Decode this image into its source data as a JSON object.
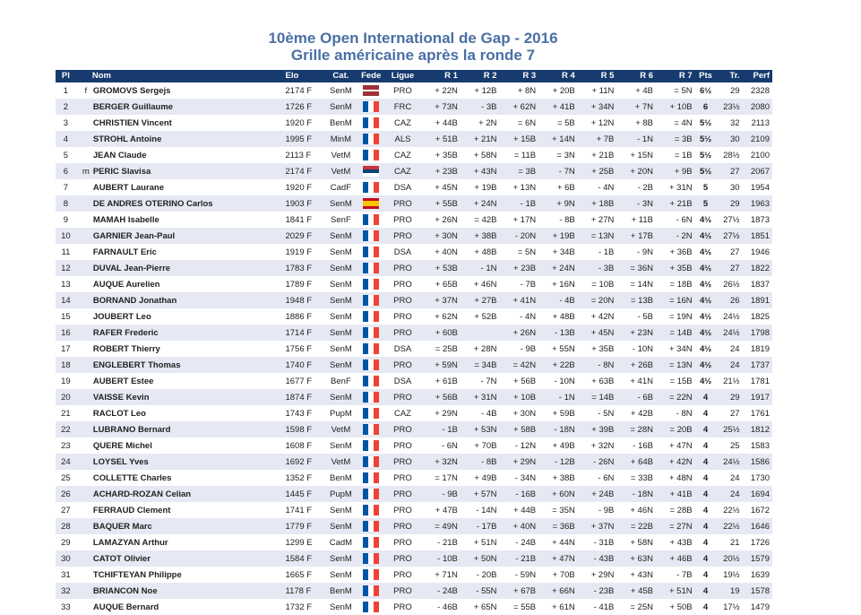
{
  "header": {
    "title": "10ème Open International de Gap - 2016",
    "subtitle": "Grille américaine après la ronde 7"
  },
  "columns": [
    "Pl",
    "Nom",
    "Elo",
    "Cat.",
    "Fede",
    "Ligue",
    "R 1",
    "R 2",
    "R 3",
    "R 4",
    "R 5",
    "R 6",
    "R 7",
    "Pts",
    "Tr.",
    "Perf"
  ],
  "flag_colors": {
    "FRA": [
      "#0055a4",
      "#ffffff",
      "#ef4135"
    ],
    "LAT": [
      "#9e3039",
      "#ffffff",
      "#9e3039"
    ],
    "SRB": [
      "#c6363c",
      "#0c4076",
      "#ffffff"
    ],
    "ESP": [
      "#c60b1e",
      "#ffc400",
      "#c60b1e"
    ]
  },
  "rows": [
    {
      "pl": "1",
      "title": "f",
      "name": "GROMOVS Sergejs",
      "elo": "2174 F",
      "cat": "SenM",
      "fede": "LAT",
      "ligue": "PRO",
      "r": [
        "+ 22N",
        "+ 12B",
        "+ 8N",
        "+ 20B",
        "+ 11N",
        "+ 4B",
        "= 5N"
      ],
      "pts": "6½",
      "tr": "29",
      "perf": "2328"
    },
    {
      "pl": "2",
      "title": "",
      "name": "BERGER Guillaume",
      "elo": "1726 F",
      "cat": "SenM",
      "fede": "FRA",
      "ligue": "FRC",
      "r": [
        "+ 73N",
        "- 3B",
        "+ 62N",
        "+ 41B",
        "+ 34N",
        "+ 7N",
        "+ 10B"
      ],
      "pts": "6",
      "tr": "23½",
      "perf": "2080"
    },
    {
      "pl": "3",
      "title": "",
      "name": "CHRISTIEN Vincent",
      "elo": "1920 F",
      "cat": "BenM",
      "fede": "FRA",
      "ligue": "CAZ",
      "r": [
        "+ 44B",
        "+ 2N",
        "= 6N",
        "= 5B",
        "+ 12N",
        "+ 8B",
        "= 4N"
      ],
      "pts": "5½",
      "tr": "32",
      "perf": "2113"
    },
    {
      "pl": "4",
      "title": "",
      "name": "STROHL Antoine",
      "elo": "1995 F",
      "cat": "MinM",
      "fede": "FRA",
      "ligue": "ALS",
      "r": [
        "+ 51B",
        "+ 21N",
        "+ 15B",
        "+ 14N",
        "+ 7B",
        "- 1N",
        "= 3B"
      ],
      "pts": "5½",
      "tr": "30",
      "perf": "2109"
    },
    {
      "pl": "5",
      "title": "",
      "name": "JEAN Claude",
      "elo": "2113 F",
      "cat": "VetM",
      "fede": "FRA",
      "ligue": "CAZ",
      "r": [
        "+ 35B",
        "+ 58N",
        "= 11B",
        "= 3N",
        "+ 21B",
        "+ 15N",
        "= 1B"
      ],
      "pts": "5½",
      "tr": "28½",
      "perf": "2100"
    },
    {
      "pl": "6",
      "title": "m",
      "name": "PERIC Slavisa",
      "elo": "2174 F",
      "cat": "VetM",
      "fede": "SRB",
      "ligue": "CAZ",
      "r": [
        "+ 23B",
        "+ 43N",
        "= 3B",
        "- 7N",
        "+ 25B",
        "+ 20N",
        "+ 9B"
      ],
      "pts": "5½",
      "tr": "27",
      "perf": "2067"
    },
    {
      "pl": "7",
      "title": "",
      "name": "AUBERT Laurane",
      "elo": "1920 F",
      "cat": "CadF",
      "fede": "FRA",
      "ligue": "DSA",
      "r": [
        "+ 45N",
        "+ 19B",
        "+ 13N",
        "+ 6B",
        "- 4N",
        "- 2B",
        "+ 31N"
      ],
      "pts": "5",
      "tr": "30",
      "perf": "1954"
    },
    {
      "pl": "8",
      "title": "",
      "name": "DE ANDRES OTERINO Carlos",
      "elo": "1903 F",
      "cat": "SenM",
      "fede": "ESP",
      "ligue": "PRO",
      "r": [
        "+ 55B",
        "+ 24N",
        "- 1B",
        "+ 9N",
        "+ 18B",
        "- 3N",
        "+ 21B"
      ],
      "pts": "5",
      "tr": "29",
      "perf": "1963"
    },
    {
      "pl": "9",
      "title": "",
      "name": "MAMAH Isabelle",
      "elo": "1841 F",
      "cat": "SenF",
      "fede": "FRA",
      "ligue": "PRO",
      "r": [
        "+ 26N",
        "= 42B",
        "+ 17N",
        "- 8B",
        "+ 27N",
        "+ 11B",
        "- 6N"
      ],
      "pts": "4½",
      "tr": "27½",
      "perf": "1873"
    },
    {
      "pl": "10",
      "title": "",
      "name": "GARNIER Jean-Paul",
      "elo": "2029 F",
      "cat": "SenM",
      "fede": "FRA",
      "ligue": "PRO",
      "r": [
        "+ 30N",
        "+ 38B",
        "- 20N",
        "+ 19B",
        "= 13N",
        "+ 17B",
        "- 2N"
      ],
      "pts": "4½",
      "tr": "27½",
      "perf": "1851"
    },
    {
      "pl": "11",
      "title": "",
      "name": "FARNAULT Eric",
      "elo": "1919 F",
      "cat": "SenM",
      "fede": "FRA",
      "ligue": "DSA",
      "r": [
        "+ 40N",
        "+ 48B",
        "= 5N",
        "+ 34B",
        "- 1B",
        "- 9N",
        "+ 36B"
      ],
      "pts": "4½",
      "tr": "27",
      "perf": "1946"
    },
    {
      "pl": "12",
      "title": "",
      "name": "DUVAL Jean-Pierre",
      "elo": "1783 F",
      "cat": "SenM",
      "fede": "FRA",
      "ligue": "PRO",
      "r": [
        "+ 53B",
        "- 1N",
        "+ 23B",
        "+ 24N",
        "- 3B",
        "= 36N",
        "+ 35B"
      ],
      "pts": "4½",
      "tr": "27",
      "perf": "1822"
    },
    {
      "pl": "13",
      "title": "",
      "name": "AUQUE Aurelien",
      "elo": "1789 F",
      "cat": "SenM",
      "fede": "FRA",
      "ligue": "PRO",
      "r": [
        "+ 65B",
        "+ 46N",
        "- 7B",
        "+ 16N",
        "= 10B",
        "= 14N",
        "= 18B"
      ],
      "pts": "4½",
      "tr": "26½",
      "perf": "1837"
    },
    {
      "pl": "14",
      "title": "",
      "name": "BORNAND Jonathan",
      "elo": "1948 F",
      "cat": "SenM",
      "fede": "FRA",
      "ligue": "PRO",
      "r": [
        "+ 37N",
        "+ 27B",
        "+ 41N",
        "- 4B",
        "= 20N",
        "= 13B",
        "= 16N"
      ],
      "pts": "4½",
      "tr": "26",
      "perf": "1891"
    },
    {
      "pl": "15",
      "title": "",
      "name": "JOUBERT Leo",
      "elo": "1886 F",
      "cat": "SenM",
      "fede": "FRA",
      "ligue": "PRO",
      "r": [
        "+ 62N",
        "+ 52B",
        "- 4N",
        "+ 48B",
        "+ 42N",
        "- 5B",
        "= 19N"
      ],
      "pts": "4½",
      "tr": "24½",
      "perf": "1825"
    },
    {
      "pl": "16",
      "title": "",
      "name": "RAFER Frederic",
      "elo": "1714 F",
      "cat": "SenM",
      "fede": "FRA",
      "ligue": "PRO",
      "r": [
        "+ 60B",
        "",
        "+ 26N",
        "- 13B",
        "+ 45N",
        "+ 23N",
        "= 14B"
      ],
      "pts": "4½",
      "tr": "24½",
      "perf": "1798"
    },
    {
      "pl": "17",
      "title": "",
      "name": "ROBERT Thierry",
      "elo": "1756 F",
      "cat": "SenM",
      "fede": "FRA",
      "ligue": "DSA",
      "r": [
        "= 25B",
        "+ 28N",
        "- 9B",
        "+ 55N",
        "+ 35B",
        "- 10N",
        "+ 34N"
      ],
      "pts": "4½",
      "tr": "24",
      "perf": "1819"
    },
    {
      "pl": "18",
      "title": "",
      "name": "ENGLEBERT Thomas",
      "elo": "1740 F",
      "cat": "SenM",
      "fede": "FRA",
      "ligue": "PRO",
      "r": [
        "+ 59N",
        "= 34B",
        "= 42N",
        "+ 22B",
        "- 8N",
        "+ 26B",
        "= 13N"
      ],
      "pts": "4½",
      "tr": "24",
      "perf": "1737"
    },
    {
      "pl": "19",
      "title": "",
      "name": "AUBERT Estee",
      "elo": "1677 F",
      "cat": "BenF",
      "fede": "FRA",
      "ligue": "DSA",
      "r": [
        "+ 61B",
        "- 7N",
        "+ 56B",
        "- 10N",
        "+ 63B",
        "+ 41N",
        "= 15B"
      ],
      "pts": "4½",
      "tr": "21½",
      "perf": "1781"
    },
    {
      "pl": "20",
      "title": "",
      "name": "VAISSE Kevin",
      "elo": "1874 F",
      "cat": "SenM",
      "fede": "FRA",
      "ligue": "PRO",
      "r": [
        "+ 56B",
        "+ 31N",
        "+ 10B",
        "- 1N",
        "= 14B",
        "- 6B",
        "= 22N"
      ],
      "pts": "4",
      "tr": "29",
      "perf": "1917"
    },
    {
      "pl": "21",
      "title": "",
      "name": "RACLOT Leo",
      "elo": "1743 F",
      "cat": "PupM",
      "fede": "FRA",
      "ligue": "CAZ",
      "r": [
        "+ 29N",
        "- 4B",
        "+ 30N",
        "+ 59B",
        "- 5N",
        "+ 42B",
        "- 8N"
      ],
      "pts": "4",
      "tr": "27",
      "perf": "1761"
    },
    {
      "pl": "22",
      "title": "",
      "name": "LUBRANO Bernard",
      "elo": "1598 F",
      "cat": "VetM",
      "fede": "FRA",
      "ligue": "PRO",
      "r": [
        "- 1B",
        "+ 53N",
        "+ 58B",
        "- 18N",
        "+ 39B",
        "= 28N",
        "= 20B"
      ],
      "pts": "4",
      "tr": "25½",
      "perf": "1812"
    },
    {
      "pl": "23",
      "title": "",
      "name": "QUERE Michel",
      "elo": "1608 F",
      "cat": "SenM",
      "fede": "FRA",
      "ligue": "PRO",
      "r": [
        "- 6N",
        "+ 70B",
        "- 12N",
        "+ 49B",
        "+ 32N",
        "- 16B",
        "+ 47N"
      ],
      "pts": "4",
      "tr": "25",
      "perf": "1583"
    },
    {
      "pl": "24",
      "title": "",
      "name": "LOYSEL Yves",
      "elo": "1692 F",
      "cat": "VetM",
      "fede": "FRA",
      "ligue": "PRO",
      "r": [
        "+ 32N",
        "- 8B",
        "+ 29N",
        "- 12B",
        "- 26N",
        "+ 64B",
        "+ 42N"
      ],
      "pts": "4",
      "tr": "24½",
      "perf": "1586"
    },
    {
      "pl": "25",
      "title": "",
      "name": "COLLETTE Charles",
      "elo": "1352 F",
      "cat": "BenM",
      "fede": "FRA",
      "ligue": "PRO",
      "r": [
        "= 17N",
        "+ 49B",
        "- 34N",
        "+ 38B",
        "- 6N",
        "= 33B",
        "+ 48N"
      ],
      "pts": "4",
      "tr": "24",
      "perf": "1730"
    },
    {
      "pl": "26",
      "title": "",
      "name": "ACHARD-ROZAN Celian",
      "elo": "1445 F",
      "cat": "PupM",
      "fede": "FRA",
      "ligue": "PRO",
      "r": [
        "- 9B",
        "+ 57N",
        "- 16B",
        "+ 60N",
        "+ 24B",
        "- 18N",
        "+ 41B"
      ],
      "pts": "4",
      "tr": "24",
      "perf": "1694"
    },
    {
      "pl": "27",
      "title": "",
      "name": "FERRAUD Clement",
      "elo": "1741 F",
      "cat": "SenM",
      "fede": "FRA",
      "ligue": "PRO",
      "r": [
        "+ 47B",
        "- 14N",
        "+ 44B",
        "= 35N",
        "- 9B",
        "+ 46N",
        "= 28B"
      ],
      "pts": "4",
      "tr": "22½",
      "perf": "1672"
    },
    {
      "pl": "28",
      "title": "",
      "name": "BAQUER Marc",
      "elo": "1779 F",
      "cat": "SenM",
      "fede": "FRA",
      "ligue": "PRO",
      "r": [
        "= 49N",
        "- 17B",
        "+ 40N",
        "= 36B",
        "+ 37N",
        "= 22B",
        "= 27N"
      ],
      "pts": "4",
      "tr": "22½",
      "perf": "1646"
    },
    {
      "pl": "29",
      "title": "",
      "name": "LAMAZYAN Arthur",
      "elo": "1299 E",
      "cat": "CadM",
      "fede": "FRA",
      "ligue": "PRO",
      "r": [
        "- 21B",
        "+ 51N",
        "- 24B",
        "+ 44N",
        "- 31B",
        "+ 58N",
        "+ 43B"
      ],
      "pts": "4",
      "tr": "21",
      "perf": "1726"
    },
    {
      "pl": "30",
      "title": "",
      "name": "CATOT Olivier",
      "elo": "1584 F",
      "cat": "SenM",
      "fede": "FRA",
      "ligue": "PRO",
      "r": [
        "- 10B",
        "+ 50N",
        "- 21B",
        "+ 47N",
        "- 43B",
        "+ 63N",
        "+ 46B"
      ],
      "pts": "4",
      "tr": "20½",
      "perf": "1579"
    },
    {
      "pl": "31",
      "title": "",
      "name": "TCHIFTEYAN Philippe",
      "elo": "1665 F",
      "cat": "SenM",
      "fede": "FRA",
      "ligue": "PRO",
      "r": [
        "+ 71N",
        "- 20B",
        "- 59N",
        "+ 70B",
        "+ 29N",
        "+ 43N",
        "- 7B"
      ],
      "pts": "4",
      "tr": "19½",
      "perf": "1639"
    },
    {
      "pl": "32",
      "title": "",
      "name": "BRIANCON Noe",
      "elo": "1178 F",
      "cat": "BenM",
      "fede": "FRA",
      "ligue": "PRO",
      "r": [
        "- 24B",
        "- 55N",
        "+ 67B",
        "+ 66N",
        "- 23B",
        "+ 45B",
        "+ 51N"
      ],
      "pts": "4",
      "tr": "19",
      "perf": "1578"
    },
    {
      "pl": "33",
      "title": "",
      "name": "AUQUE Bernard",
      "elo": "1732 F",
      "cat": "SenM",
      "fede": "FRA",
      "ligue": "PRO",
      "r": [
        "- 46B",
        "+ 65N",
        "= 55B",
        "+ 61N",
        "- 41B",
        "= 25N",
        "+ 50B"
      ],
      "pts": "4",
      "tr": "17½",
      "perf": "1479"
    }
  ]
}
